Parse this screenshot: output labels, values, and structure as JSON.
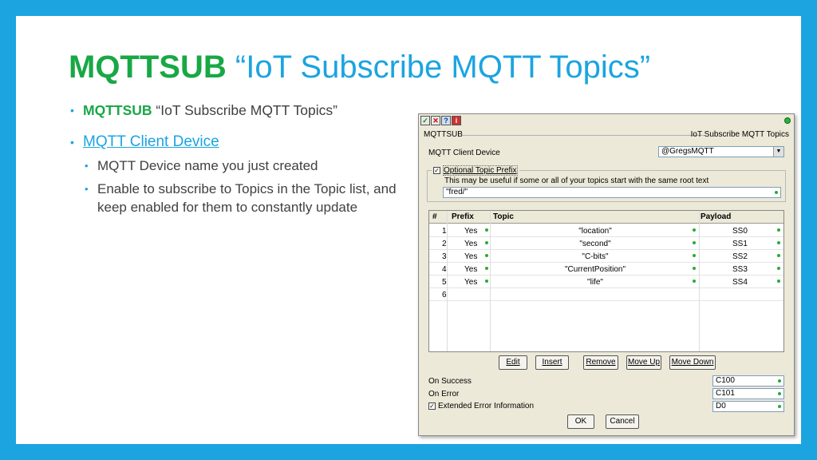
{
  "slide": {
    "title_keyword": "MQTTSUB",
    "title_rest": "“IoT Subscribe MQTT Topics”",
    "bullet1_keyword": "MQTTSUB",
    "bullet1_rest": "“IoT Subscribe MQTT Topics”",
    "bullet2_link": "MQTT Client Device",
    "sub_bullets": [
      "MQTT Device name you just created",
      "Enable to subscribe to Topics in the Topic list, and keep enabled for them to constantly update"
    ]
  },
  "dialog": {
    "toolbar_icons": [
      "check-icon",
      "close-icon",
      "help-icon",
      "info-icon"
    ],
    "group_title": "MQTTSUB",
    "group_right": "IoT Subscribe MQTT Topics",
    "client_device_label": "MQTT Client Device",
    "client_device_value": "@GregsMQTT",
    "prefix_checkbox_label": "Optional Topic Prefix",
    "prefix_checked": true,
    "prefix_hint": "This may be useful if some or all of your topics start with the same root text",
    "prefix_value": "\"fred/\"",
    "table": {
      "headers": [
        "#",
        "Prefix",
        "Topic",
        "Payload"
      ],
      "rows": [
        {
          "num": "1",
          "prefix": "Yes",
          "topic": "\"location\"",
          "payload": "SS0"
        },
        {
          "num": "2",
          "prefix": "Yes",
          "topic": "\"second\"",
          "payload": "SS1"
        },
        {
          "num": "3",
          "prefix": "Yes",
          "topic": "\"C-bits\"",
          "payload": "SS2"
        },
        {
          "num": "4",
          "prefix": "Yes",
          "topic": "\"CurrentPosition\"",
          "payload": "SS3"
        },
        {
          "num": "5",
          "prefix": "Yes",
          "topic": "\"life\"",
          "payload": "SS4"
        },
        {
          "num": "6",
          "prefix": "",
          "topic": "",
          "payload": ""
        }
      ]
    },
    "buttons": {
      "edit": "Edit",
      "insert": "Insert",
      "remove": "Remove",
      "move_up": "Move Up",
      "move_down": "Move Down",
      "ok": "OK",
      "cancel": "Cancel"
    },
    "on_success_label": "On Success",
    "on_success_value": "C100",
    "on_error_label": "On Error",
    "on_error_value": "C101",
    "extended_error_label": "Extended Error Information",
    "extended_error_checked": true,
    "extended_error_value": "D0"
  },
  "colors": {
    "frame_blue": "#1ba4e0",
    "keyword_green": "#18a845"
  }
}
